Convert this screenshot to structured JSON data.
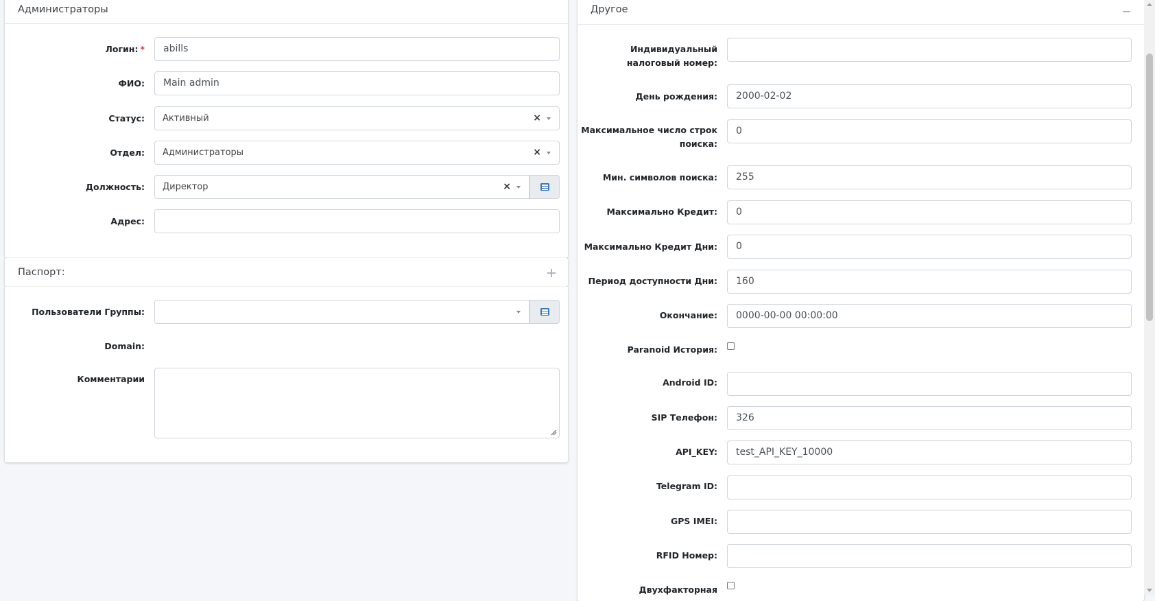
{
  "admin_card": {
    "title": "Администраторы",
    "fields": {
      "login": {
        "label": "Логин:",
        "required": "*",
        "value": "abills"
      },
      "fio": {
        "label": "ФИО:",
        "value": "Main admin"
      },
      "status": {
        "label": "Статус:",
        "value": "Активный",
        "clear": "×"
      },
      "department": {
        "label": "Отдел:",
        "value": "Администраторы",
        "clear": "×"
      },
      "position": {
        "label": "Должность:",
        "value": "Директор",
        "clear": "×",
        "button_icon": "list-icon"
      },
      "address": {
        "label": "Адрес:",
        "value": ""
      }
    }
  },
  "passport_card": {
    "title": "Паспорт:",
    "toggle_icon": "plus-icon"
  },
  "groups_card": {
    "fields": {
      "user_groups": {
        "label": "Пользователи Группы:",
        "value": "",
        "button_icon": "list-icon"
      },
      "domain": {
        "label": "Domain:"
      },
      "comments": {
        "label": "Комментарии",
        "value": ""
      }
    }
  },
  "other_card": {
    "title": "Другое",
    "toggle_icon": "minus-icon",
    "fields": {
      "inn": {
        "label_line1": "Индивидуальный",
        "label_line2": "налоговый номер:",
        "value": ""
      },
      "birthday": {
        "label": "День рождения:",
        "value": "2000-02-02"
      },
      "max_rows": {
        "label_line1": "Максимальное число строк",
        "label_line2": "поиска:",
        "value": "0"
      },
      "min_search_chars": {
        "label": "Мин. символов поиска:",
        "value": "255"
      },
      "max_credit": {
        "label": "Максимально Кредит:",
        "value": "0"
      },
      "max_credit_days": {
        "label": "Максимально Кредит Дни:",
        "value": "0"
      },
      "access_period_days": {
        "label": "Период доступности Дни:",
        "value": "160"
      },
      "expire": {
        "label": "Окончание:",
        "value": "0000-00-00 00:00:00"
      },
      "paranoid_history": {
        "label": "Paranoid История:",
        "checked": false
      },
      "android_id": {
        "label": "Android ID:",
        "value": ""
      },
      "sip_phone": {
        "label": "SIP Телефон:",
        "value": "326"
      },
      "api_key": {
        "label": "API_KEY:",
        "value": "test_API_KEY_10000"
      },
      "telegram_id": {
        "label": "Telegram ID:",
        "value": ""
      },
      "gps_imei": {
        "label": "GPS IMEI:",
        "value": ""
      },
      "rfid_number": {
        "label": "RFID Номер:",
        "value": ""
      },
      "two_factor": {
        "label": "Двухфакторная",
        "checked": false
      }
    }
  },
  "colors": {
    "background": "#f4f6f9",
    "card": "#ffffff",
    "required": "#dc3545",
    "accent_icon": "#3c79b7"
  }
}
